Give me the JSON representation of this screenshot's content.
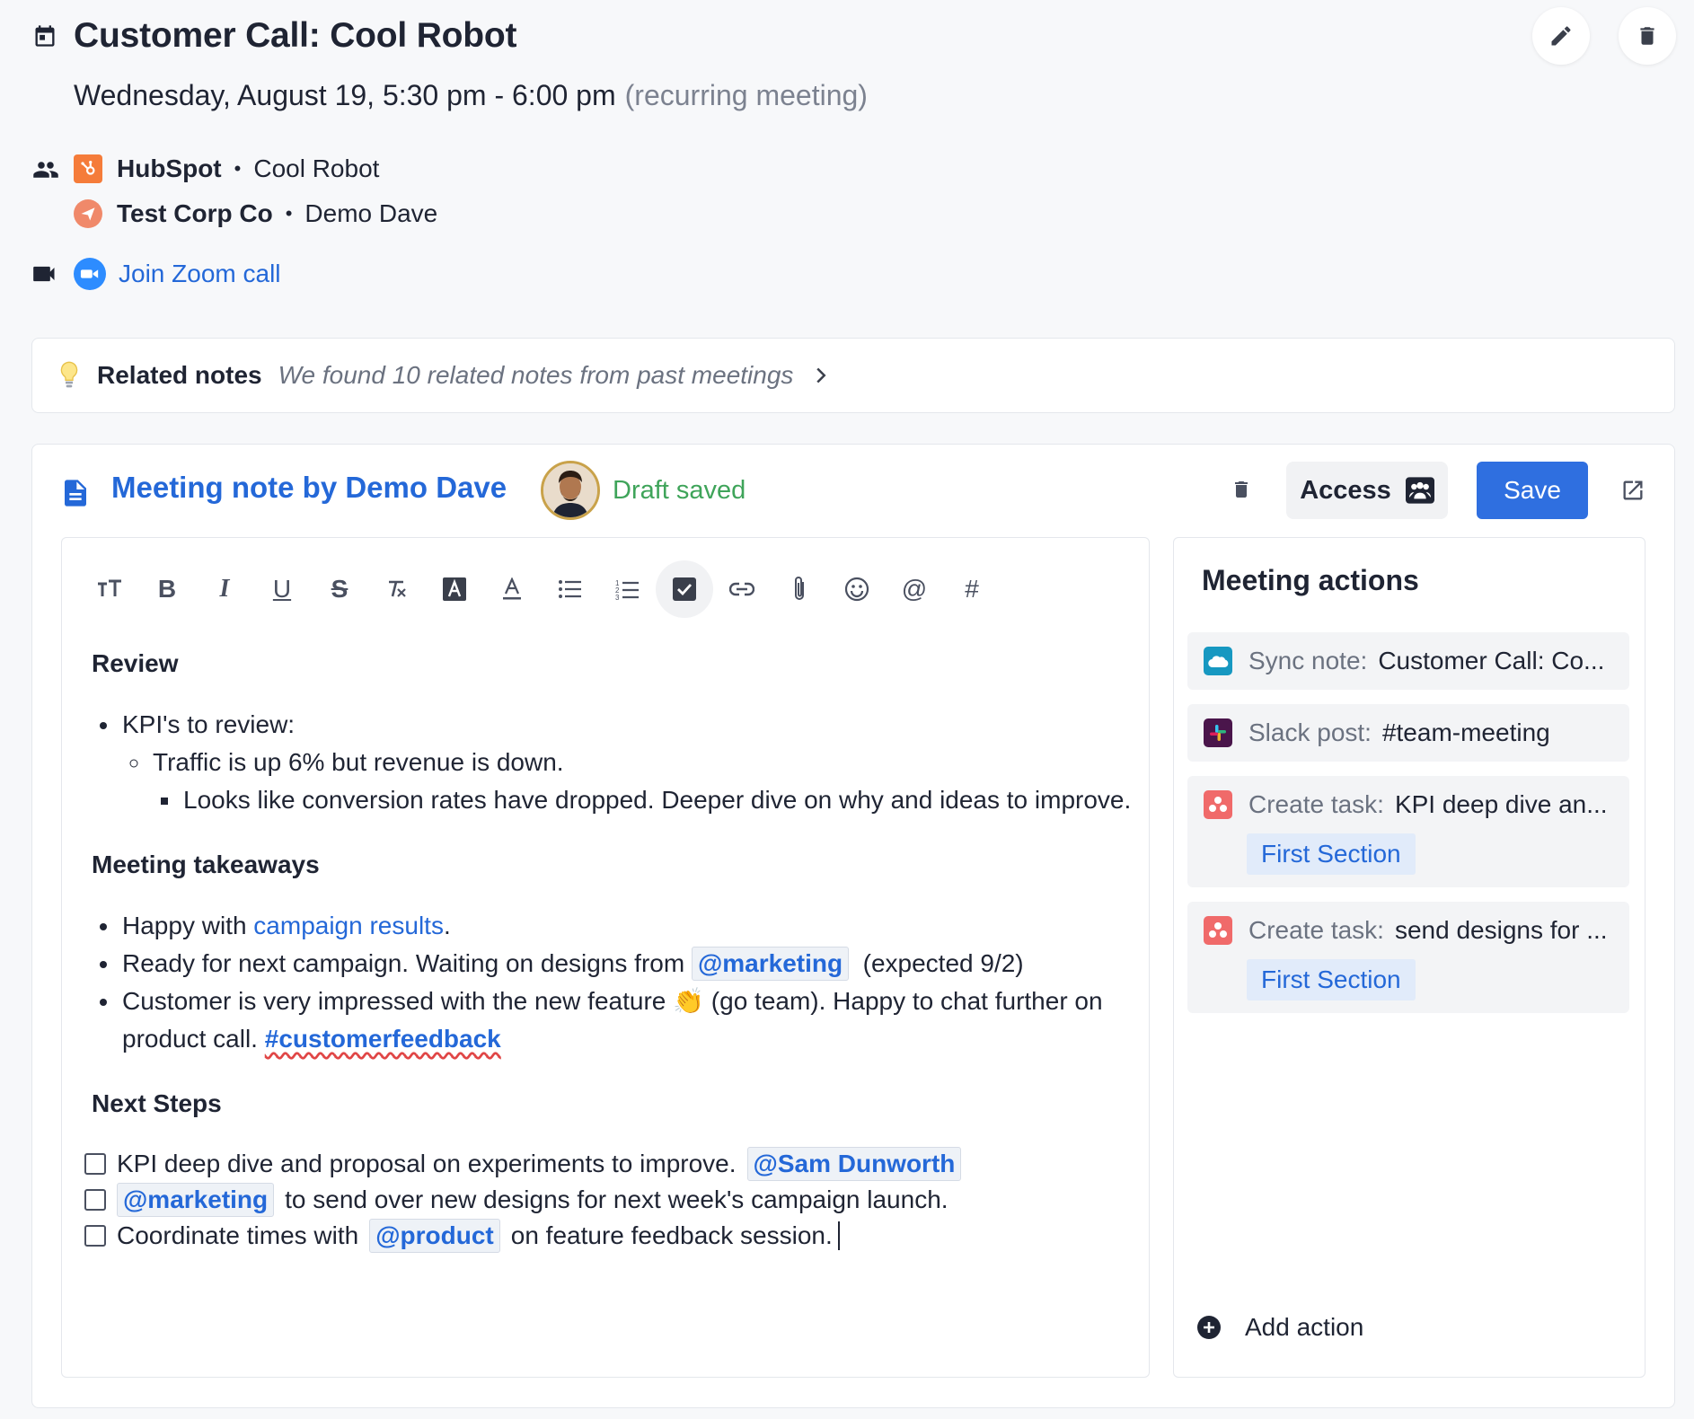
{
  "header": {
    "title": "Customer Call: Cool Robot",
    "datetime": "Wednesday, August 19, 5:30 pm - 6:00 pm",
    "recurring": "(recurring meeting)"
  },
  "participants": [
    {
      "org": "HubSpot",
      "person": "Cool Robot"
    },
    {
      "org": "Test Corp Co",
      "person": "Demo Dave"
    }
  ],
  "zoom": {
    "label": "Join Zoom call"
  },
  "related": {
    "label": "Related notes",
    "text": "We found 10 related notes from past meetings"
  },
  "note": {
    "title": "Meeting note by Demo Dave",
    "status": "Draft saved",
    "access_label": "Access",
    "save_label": "Save"
  },
  "toolbar": [
    "text-size-icon",
    "bold-icon",
    "italic-icon",
    "underline-icon",
    "strikethrough-icon",
    "clear-format-icon",
    "highlight-icon",
    "font-color-icon",
    "bullet-list-icon",
    "numbered-list-icon",
    "checklist-icon",
    "link-icon",
    "attachment-icon",
    "emoji-icon",
    "mention-icon",
    "hashtag-icon"
  ],
  "content": {
    "review": {
      "heading": "Review",
      "kpi": "KPI's to review:",
      "traffic": "Traffic is up 6% but revenue is down.",
      "conversion": "Looks like conversion rates have dropped. Deeper dive on why and ideas to improve."
    },
    "takeaways": {
      "heading": "Meeting takeaways",
      "b1_pre": "Happy with",
      "b1_link": "campaign results",
      "b1_post": ".",
      "b2_pre": "Ready for next campaign. Waiting on designs from",
      "b2_mention": "@marketing",
      "b2_post": "(expected 9/2)",
      "b3_pre": "Customer is very impressed with the new feature",
      "b3_emoji": "👏",
      "b3_post": "(go team). Happy to chat further on product call.",
      "b3_hashtag": "#customerfeedback"
    },
    "next_steps": {
      "heading": "Next Steps",
      "t1_text": "KPI deep dive and proposal on experiments to improve.",
      "t1_mention": "@Sam Dunworth",
      "t2_mention": "@marketing",
      "t2_text": "to send over new designs for next week's campaign launch.",
      "t3_pre": "Coordinate times with",
      "t3_mention": "@product",
      "t3_post": "on feature feedback session."
    }
  },
  "actions": {
    "title": "Meeting actions",
    "items": [
      {
        "kind": "Sync note:",
        "value": "Customer Call: Co...",
        "icon": "salesforce-icon",
        "color": "#1798c1"
      },
      {
        "kind": "Slack post:",
        "value": "#team-meeting",
        "icon": "slack-icon",
        "color": "#4a154b"
      },
      {
        "kind": "Create task:",
        "value": "KPI deep dive an...",
        "icon": "asana-icon",
        "color": "#f06a6a",
        "section": "First Section"
      },
      {
        "kind": "Create task:",
        "value": "send designs for ...",
        "icon": "asana-icon",
        "color": "#f06a6a",
        "section": "First Section"
      }
    ],
    "add_label": "Add action"
  },
  "colors": {
    "link": "#2468d8",
    "save": "#2f6fe0",
    "draft": "#3fa45a",
    "hubspot": "#f57c3a"
  }
}
